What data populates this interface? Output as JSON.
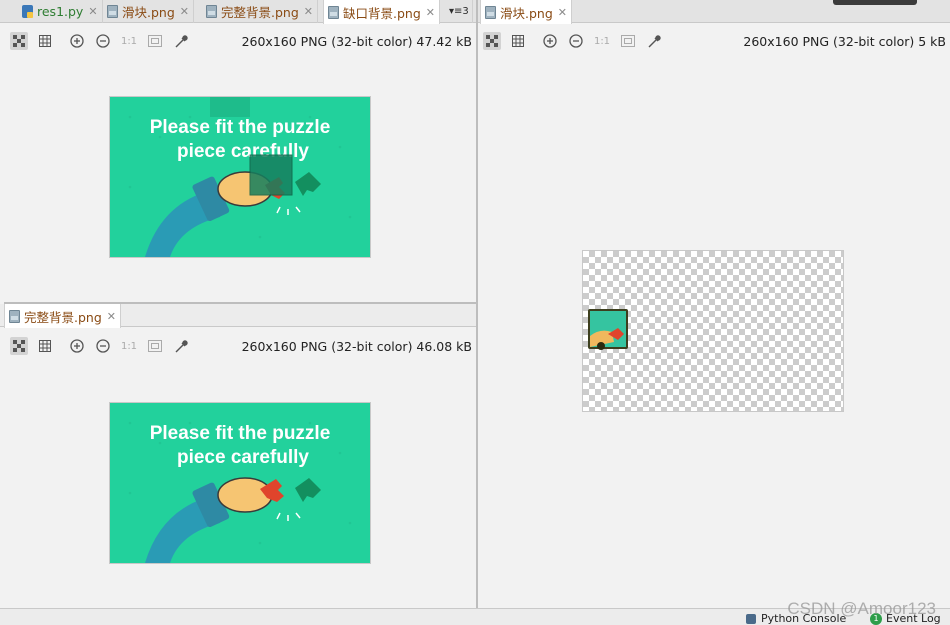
{
  "top_tabs": [
    {
      "label": "res1.py",
      "type": "py",
      "color": "#2e7d32"
    },
    {
      "label": "滑块.png",
      "type": "png",
      "color": "#8a4b14"
    },
    {
      "label": "完整背景.png",
      "type": "png",
      "color": "#8a4b14"
    },
    {
      "label": "缺口背景.png",
      "type": "png",
      "color": "#8a4b14",
      "active": true
    }
  ],
  "overflow_tabs": "3",
  "right_tab": {
    "label": "滑块.png"
  },
  "bottom_left_tab": {
    "label": "完整背景.png"
  },
  "panels": {
    "top_left": {
      "info": "260x160 PNG (32-bit color) 47.42 kB"
    },
    "bottom_left": {
      "info": "260x160 PNG (32-bit color) 46.08 kB"
    },
    "right": {
      "info": "260x160 PNG (32-bit color) 5 kB"
    }
  },
  "toolbar": {
    "transparency_icon": "checker-icon",
    "grid_icon": "grid-icon",
    "zoom_in_icon": "zoom-in-icon",
    "zoom_out_icon": "zoom-out-icon",
    "actual_size": "1:1",
    "fit_icon": "fit-icon",
    "picker_icon": "eyedropper-icon"
  },
  "image_text": {
    "line1": "Please fit the puzzle",
    "line2": "piece carefully"
  },
  "status_bar": {
    "python_console": "Python Console",
    "event_log": "Event Log",
    "event_count": "1"
  },
  "watermark": "CSDN @Amoor123",
  "colors": {
    "image_bg": "#22d19c",
    "accent_tab_text": "#8a4b14"
  }
}
